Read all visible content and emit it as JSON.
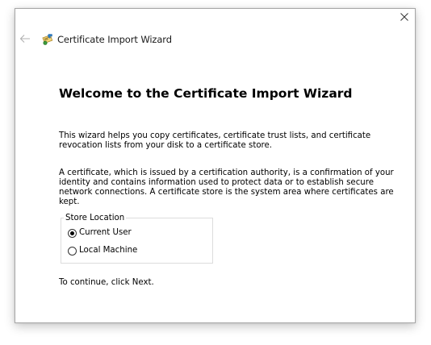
{
  "header": {
    "title": "Certificate Import Wizard",
    "back_icon": "back-arrow-icon",
    "wizard_icon": "certificate-icon",
    "close_icon": "close-icon"
  },
  "main": {
    "heading": "Welcome to the Certificate Import Wizard",
    "paragraph1": "This wizard helps you copy certificates, certificate trust lists, and certificate revocation lists from your disk to a certificate store.",
    "paragraph2": "A certificate, which is issued by a certification authority, is a confirmation of your identity and contains information used to protect data or to establish secure network connections. A certificate store is the system area where certificates are kept.",
    "store_location": {
      "legend": "Store Location",
      "options": [
        {
          "label": "Current User",
          "selected": true
        },
        {
          "label": "Local Machine",
          "selected": false
        }
      ]
    },
    "continue_text": "To continue, click Next."
  }
}
